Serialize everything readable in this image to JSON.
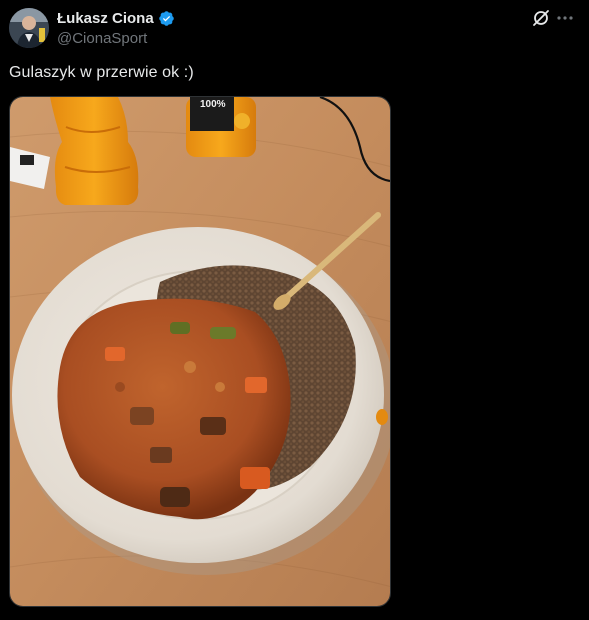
{
  "author": {
    "display_name": "Łukasz Ciona",
    "handle": "@CionaSport",
    "verified": true
  },
  "tweet": {
    "text": "Gulaszyk w przerwie ok :)"
  },
  "media": {
    "bottle_label": "100%"
  },
  "icons": {
    "verified": "verified-badge-icon",
    "grok": "grok-icon",
    "more": "more-dots-icon"
  },
  "colors": {
    "verified_blue": "#1d9bf0",
    "text_primary": "#e7e9ea",
    "text_secondary": "#71767b"
  }
}
